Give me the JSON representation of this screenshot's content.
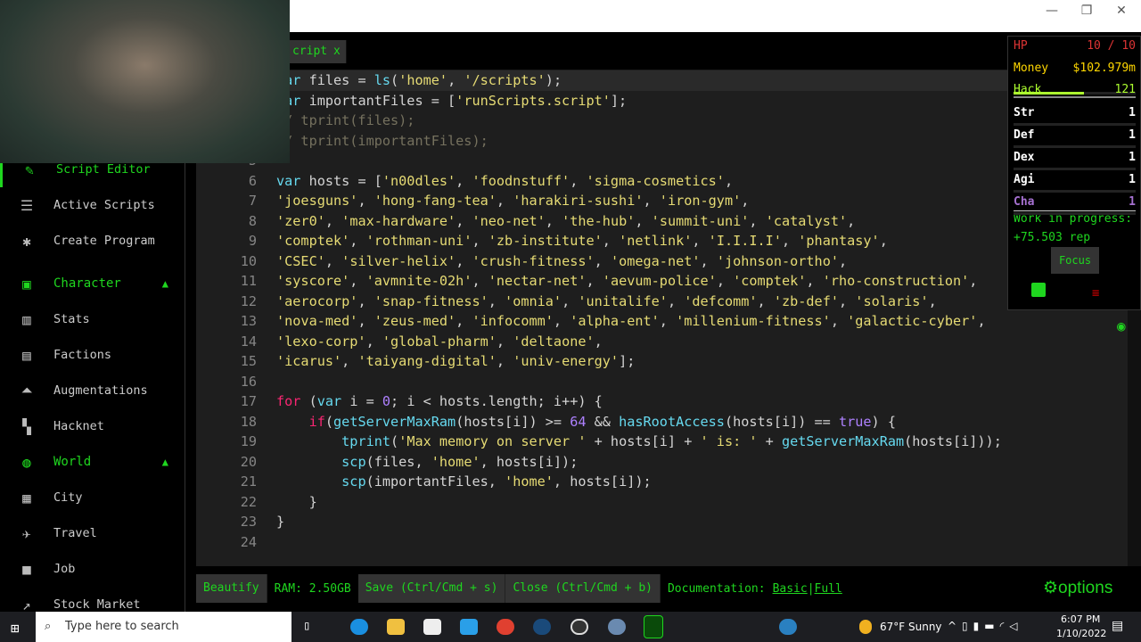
{
  "window": {
    "minimize": "—",
    "restore": "❐",
    "close": "✕"
  },
  "tab": {
    "label": "cript",
    "close": "x"
  },
  "sidebar": {
    "items": [
      {
        "label": "Script Editor",
        "icon": "pencil-icon",
        "glyph": "✎",
        "kind": "active"
      },
      {
        "label": "Active Scripts",
        "icon": "list-icon",
        "glyph": "☰",
        "kind": ""
      },
      {
        "label": "Create Program",
        "icon": "bug-icon",
        "glyph": "✱",
        "kind": ""
      },
      {
        "label": "Character",
        "icon": "account-box-icon",
        "glyph": "▣",
        "kind": "head"
      },
      {
        "label": "Stats",
        "icon": "bar-chart-icon",
        "glyph": "▥",
        "kind": ""
      },
      {
        "label": "Factions",
        "icon": "contacts-icon",
        "glyph": "▤",
        "kind": ""
      },
      {
        "label": "Augmentations",
        "icon": "double-arrow-up-icon",
        "glyph": "⏶",
        "kind": ""
      },
      {
        "label": "Hacknet",
        "icon": "hacknet-icon",
        "glyph": "▚",
        "kind": ""
      },
      {
        "label": "World",
        "icon": "globe-icon",
        "glyph": "◍",
        "kind": "head"
      },
      {
        "label": "City",
        "icon": "city-icon",
        "glyph": "▦",
        "kind": ""
      },
      {
        "label": "Travel",
        "icon": "airplane-icon",
        "glyph": "✈",
        "kind": ""
      },
      {
        "label": "Job",
        "icon": "briefcase-icon",
        "glyph": "■",
        "kind": ""
      },
      {
        "label": "Stock Market",
        "icon": "trending-up-icon",
        "glyph": "↗",
        "kind": ""
      }
    ]
  },
  "editor": {
    "lines": [
      "var files = ls('home', '/scripts');",
      "var importantFiles = ['runScripts.script'];",
      "// tprint(files);",
      "// tprint(importantFiles);",
      "",
      "var hosts = ['n00dles', 'foodnstuff', 'sigma-cosmetics',",
      "'joesguns', 'hong-fang-tea', 'harakiri-sushi', 'iron-gym',",
      "'zer0', 'max-hardware', 'neo-net', 'the-hub', 'summit-uni', 'catalyst',",
      "'comptek', 'rothman-uni', 'zb-institute', 'netlink', 'I.I.I.I', 'phantasy',",
      "'CSEC', 'silver-helix', 'crush-fitness', 'omega-net', 'johnson-ortho',",
      "'syscore', 'avmnite-02h', 'nectar-net', 'aevum-police', 'comptek', 'rho-construction',",
      "'aerocorp', 'snap-fitness', 'omnia', 'unitalife', 'defcomm', 'zb-def', 'solaris',",
      "'nova-med', 'zeus-med', 'infocomm', 'alpha-ent', 'millenium-fitness', 'galactic-cyber',",
      "'lexo-corp', 'global-pharm', 'deltaone',",
      "'icarus', 'taiyang-digital', 'univ-energy'];",
      "",
      "for (var i = 0; i < hosts.length; i++) {",
      "    if(getServerMaxRam(hosts[i]) >= 64 && hasRootAccess(hosts[i]) == true) {",
      "        tprint('Max memory on server ' + hosts[i] + ' is: ' + getServerMaxRam(hosts[i]));",
      "        scp(files, 'home', hosts[i]);",
      "        scp(importantFiles, 'home', hosts[i]);",
      "    }",
      "}",
      ""
    ]
  },
  "toolbar": {
    "beautify": "Beautify",
    "ram": "RAM: 2.50GB",
    "save": "Save (Ctrl/Cmd + s)",
    "close": "Close (Ctrl/Cmd + b)",
    "docs": "Documentation:",
    "basic": "Basic",
    "sep": " |",
    "full": "Full",
    "options": "options"
  },
  "stats": {
    "rows": [
      {
        "label": "HP",
        "value": "10 / 10",
        "color": "#dd3434"
      },
      {
        "label": "Money",
        "value": "$102.979m",
        "color": "#ffd700"
      },
      {
        "label": "Hack",
        "value": "121",
        "color": "#adff2f"
      },
      {
        "label": "Str",
        "value": "1",
        "color": "#ffffff"
      },
      {
        "label": "Def",
        "value": "1",
        "color": "#ffffff"
      },
      {
        "label": "Dex",
        "value": "1",
        "color": "#ffffff"
      },
      {
        "label": "Agi",
        "value": "1",
        "color": "#ffffff"
      },
      {
        "label": "Cha",
        "value": "1",
        "color": "#a671d1"
      }
    ],
    "hack_progress": 0.58,
    "work": "Work in progress:",
    "rep": "+75.503 rep",
    "focus": "Focus"
  },
  "taskbar": {
    "search_placeholder": "Type here to search",
    "weather": "67°F Sunny",
    "time": "6:07 PM",
    "date": "1/10/2022",
    "notifications": "1"
  }
}
